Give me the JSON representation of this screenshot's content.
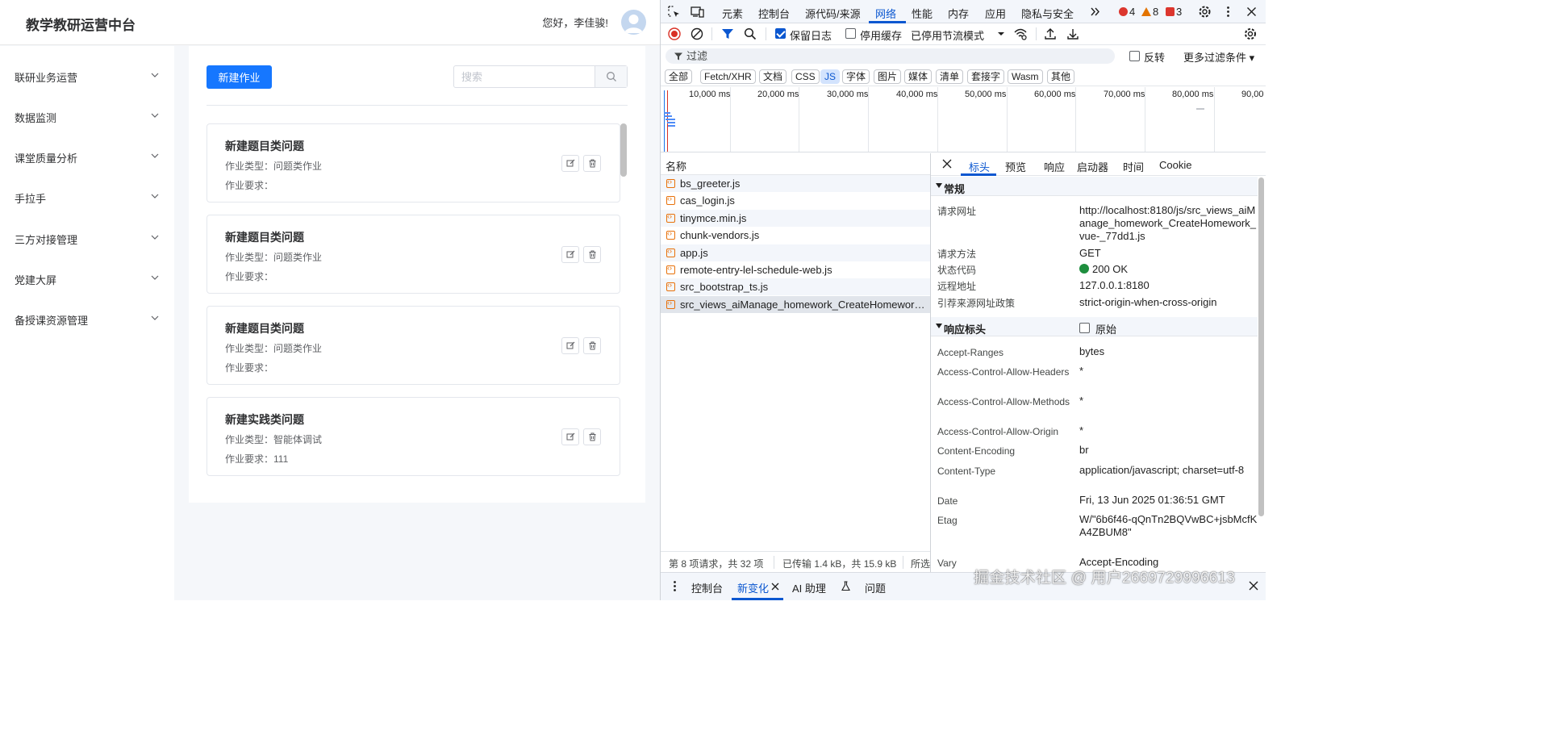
{
  "app": {
    "title": "教学教研运营中台",
    "greeting": "您好，李佳骏!",
    "sidebar": {
      "items": [
        {
          "label": "联研业务运营"
        },
        {
          "label": "数据监测"
        },
        {
          "label": "课堂质量分析"
        },
        {
          "label": "手拉手"
        },
        {
          "label": "三方对接管理"
        },
        {
          "label": "党建大屏"
        },
        {
          "label": "备授课资源管理"
        }
      ]
    },
    "toolbar": {
      "new_button": "新建作业",
      "search_placeholder": "搜索"
    },
    "cards": [
      {
        "title": "新建题目类问题",
        "type_line": "作业类型：问题类作业",
        "req_line": "作业要求："
      },
      {
        "title": "新建题目类问题",
        "type_line": "作业类型：问题类作业",
        "req_line": "作业要求："
      },
      {
        "title": "新建题目类问题",
        "type_line": "作业类型：问题类作业",
        "req_line": "作业要求："
      },
      {
        "title": "新建实践类问题",
        "type_line": "作业类型：智能体调试",
        "req_line": "作业要求：111"
      }
    ]
  },
  "devtools": {
    "tabs": [
      "元素",
      "控制台",
      "源代码/来源",
      "网络",
      "性能",
      "内存",
      "应用",
      "隐私与安全"
    ],
    "active_tab": "网络",
    "badges": {
      "errors": "4",
      "warnings": "8",
      "issues": "3"
    },
    "toolbar": {
      "preserve_log": "保留日志",
      "disable_cache": "停用缓存",
      "throttle": "已停用节流模式"
    },
    "filter": {
      "placeholder": "过滤",
      "invert": "反转",
      "more_filters": "更多过滤条件 ▾"
    },
    "type_filters": [
      "全部",
      "Fetch/XHR",
      "文档",
      "CSS",
      "JS",
      "字体",
      "图片",
      "媒体",
      "清单",
      "套接字",
      "Wasm",
      "其他"
    ],
    "active_type": "JS",
    "timeline_labels": [
      "10,000 ms",
      "20,000 ms",
      "30,000 ms",
      "40,000 ms",
      "50,000 ms",
      "60,000 ms",
      "70,000 ms",
      "80,000 ms",
      "90,00"
    ],
    "name_header": "名称",
    "requests": [
      "bs_greeter.js",
      "cas_login.js",
      "tinymce.min.js",
      "chunk-vendors.js",
      "app.js",
      "remote-entry-lel-schedule-web.js",
      "src_bootstrap_ts.js",
      "src_views_aiManage_homework_CreateHomework..."
    ],
    "status_bar": {
      "count": "第 8 项请求，共 32 项",
      "transfer": "已传输 1.4 kB，共 15.9 kB",
      "resources": "所选"
    },
    "detail_tabs": [
      "标头",
      "预览",
      "响应",
      "启动器",
      "时间",
      "Cookie"
    ],
    "active_detail_tab": "标头",
    "general": {
      "title": "常规",
      "rows": [
        {
          "key": "请求网址",
          "value": "http://localhost:8180/js/src_views_aiManage_homework_CreateHomework_vue-_77dd1.js"
        },
        {
          "key": "请求方法",
          "value": "GET"
        },
        {
          "key": "状态代码",
          "value": "200 OK"
        },
        {
          "key": "远程地址",
          "value": "127.0.0.1:8180"
        },
        {
          "key": "引荐来源网址政策",
          "value": "strict-origin-when-cross-origin"
        }
      ]
    },
    "response_headers": {
      "title": "响应标头",
      "raw_label": "原始",
      "rows": [
        {
          "key": "Accept-Ranges",
          "value": "bytes"
        },
        {
          "key": "Access-Control-Allow-Headers",
          "value": "*"
        },
        {
          "key": "Access-Control-Allow-Methods",
          "value": "*"
        },
        {
          "key": "Access-Control-Allow-Origin",
          "value": "*"
        },
        {
          "key": "Content-Encoding",
          "value": "br"
        },
        {
          "key": "Content-Type",
          "value": "application/javascript; charset=utf-8"
        },
        {
          "key": "Date",
          "value": "Fri, 13 Jun 2025 01:36:51 GMT"
        },
        {
          "key": "Etag",
          "value": "W/\"6b6f46-qQnTn2BQVwBC+jsbMcfKA4ZBUM8\""
        },
        {
          "key": "Vary",
          "value": "Accept-Encoding"
        }
      ]
    },
    "drawer_tabs": [
      "控制台",
      "新变化",
      "AI 助理",
      "问题"
    ],
    "active_drawer_tab": "新变化"
  },
  "watermark": "掘金技术社区 @ 用户2669729996613"
}
